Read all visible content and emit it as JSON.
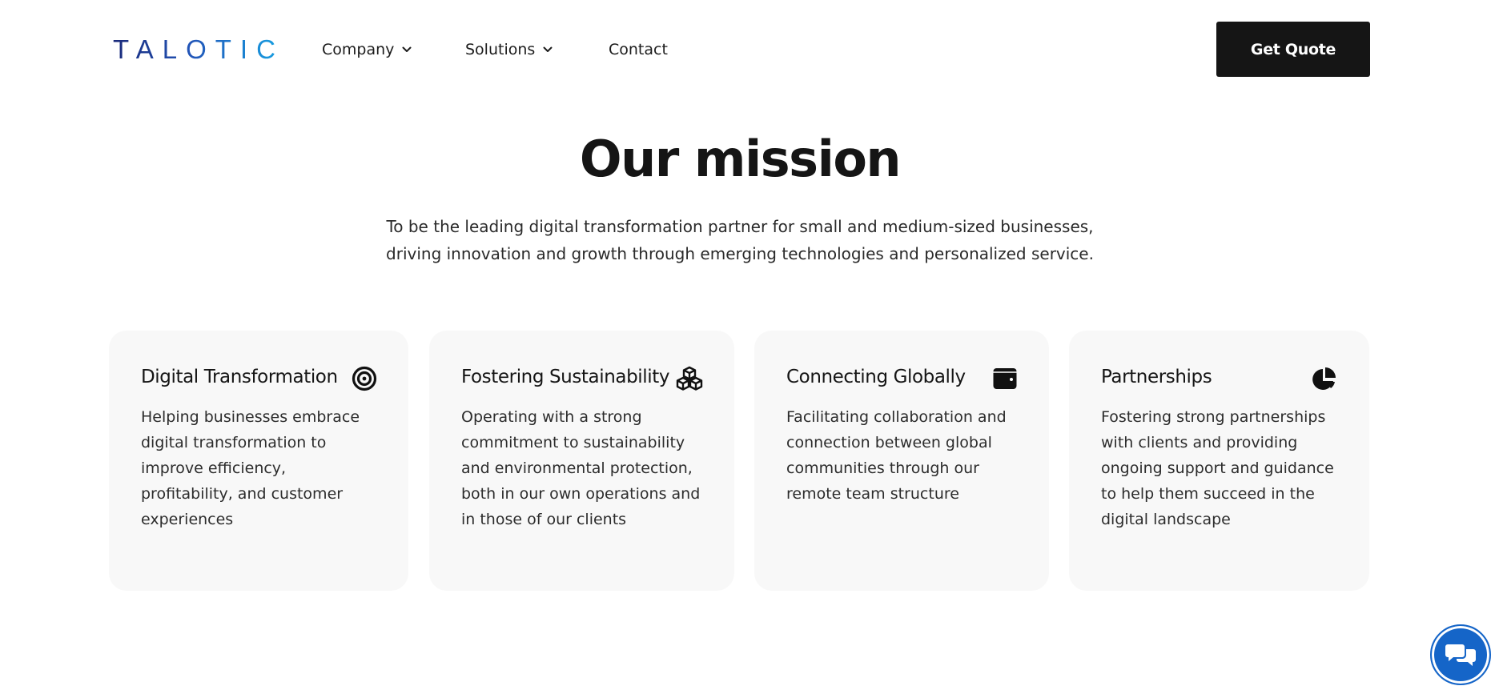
{
  "header": {
    "logo_text": "TALOTIC",
    "nav": [
      {
        "label": "Company",
        "has_dropdown": true
      },
      {
        "label": "Solutions",
        "has_dropdown": true
      },
      {
        "label": "Contact",
        "has_dropdown": false
      }
    ],
    "cta_label": "Get Quote"
  },
  "mission": {
    "title": "Our mission",
    "text": "To be the leading digital transformation partner for small and medium-sized businesses, driving innovation and growth through emerging technologies and personalized service."
  },
  "cards": [
    {
      "title": "Digital Transformation",
      "icon": "target-icon",
      "description": "Helping businesses embrace digital transformation to improve efficiency, profitability, and customer experiences"
    },
    {
      "title": "Fostering Sustainability",
      "icon": "cubes-icon",
      "description": "Operating with a strong commitment to sustainability and environmental protection, both in our own operations and in those of our clients"
    },
    {
      "title": "Connecting Globally",
      "icon": "wallet-icon",
      "description": "Facilitating collaboration and connection between global communities through our remote team structure"
    },
    {
      "title": "Partnerships",
      "icon": "pie-chart-icon",
      "description": "Fostering strong partnerships with clients and providing ongoing support and guidance to help them succeed in the digital landscape"
    }
  ],
  "chat_widget": {
    "icon": "chat-bubbles-icon"
  },
  "colors": {
    "logo_gradient_start": "#1a2a7a",
    "logo_gradient_end": "#17a2e3",
    "cta_background": "#151515",
    "card_background": "#f8f8f8",
    "chat_button": "#1565c8"
  }
}
